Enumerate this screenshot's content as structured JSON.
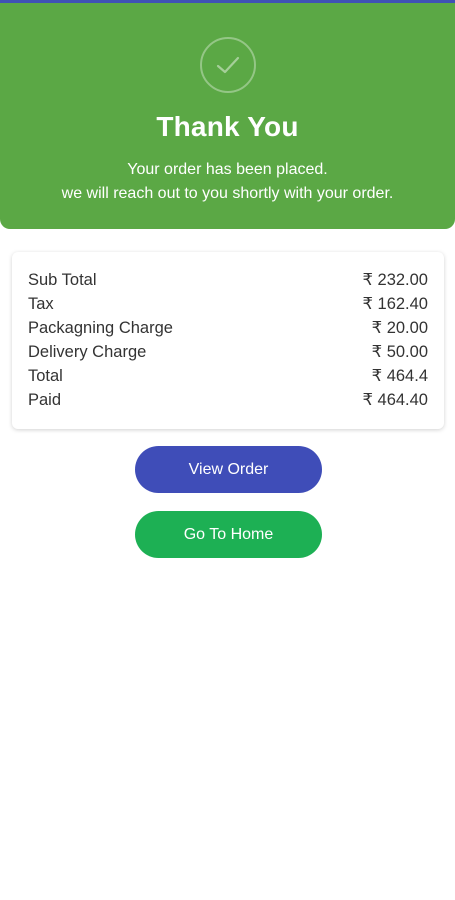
{
  "colors": {
    "hero_bg": "#5ba845",
    "view_order_bg": "#3f4db8",
    "go_home_bg": "#1db054",
    "top_accent": "#3f51b5"
  },
  "hero": {
    "icon": "check-icon",
    "title": "Thank You",
    "line1": "Your order has been placed.",
    "line2": "we will reach out to you shortly with your order."
  },
  "summary": {
    "rows": [
      {
        "label": "Sub Total",
        "value": "₹ 232.00"
      },
      {
        "label": "Tax",
        "value": "₹ 162.40"
      },
      {
        "label": "Packagning Charge",
        "value": "₹ 20.00"
      },
      {
        "label": "Delivery Charge",
        "value": "₹ 50.00"
      },
      {
        "label": "Total",
        "value": "₹ 464.4"
      },
      {
        "label": "Paid",
        "value": "₹ 464.40"
      }
    ]
  },
  "actions": {
    "view_order_label": "View Order",
    "go_home_label": "Go To Home"
  }
}
